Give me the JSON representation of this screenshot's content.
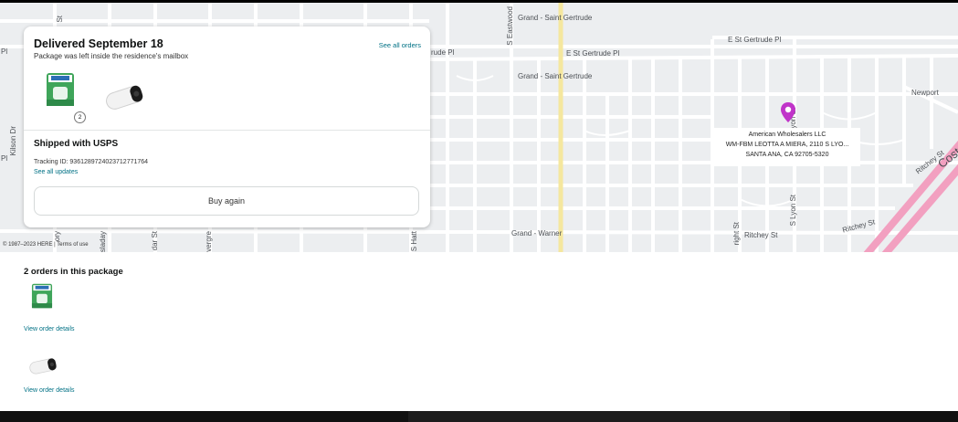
{
  "map": {
    "streets": [
      "Grand - Saint Gertrude",
      "S Eastwood",
      "rude Pl",
      "E St Gertrude Pl",
      "E St Gertrude Pl",
      "Grand - Saint Gertrude",
      "Newport",
      "Kilson Dr",
      "Costa",
      "Ritchey St",
      "S Lyon St",
      "S Lyon St",
      "Ritchey St",
      "Ritchey St",
      "Grand - Warner",
      "S Hatt",
      "vergre",
      "dar St",
      "sladay",
      "ory",
      "Pl",
      "Pl",
      "St",
      "right St"
    ],
    "copyright": "© 1987–2023 HERE | Terms of use"
  },
  "card": {
    "title": "Delivered September 18",
    "subtitle": "Package was left inside the residence's mailbox",
    "see_all_orders": "See all orders",
    "item_quantity": "2",
    "shipped_with": "Shipped with USPS",
    "tracking": "Tracking ID: 9361289724023712771764",
    "see_all_updates": "See all updates",
    "buy_again": "Buy again"
  },
  "address": {
    "line1": "American Wholesalers LLC",
    "line2": "WM-FBM LEOTTA A MIERA, 2110 S LYO...",
    "line3": "SANTA ANA, CA 92705-5320"
  },
  "orders": {
    "title": "2 orders in this package",
    "view_details": [
      "View order details",
      "View order details"
    ]
  },
  "colors": {
    "link": "#007185",
    "pin": "#c034c9",
    "highway": "#f2a0c0",
    "main_road": "#f5e79e"
  },
  "icons": [
    "location-pin-icon",
    "product-diaper-pack-thumbnail",
    "product-security-camera-thumbnail"
  ]
}
